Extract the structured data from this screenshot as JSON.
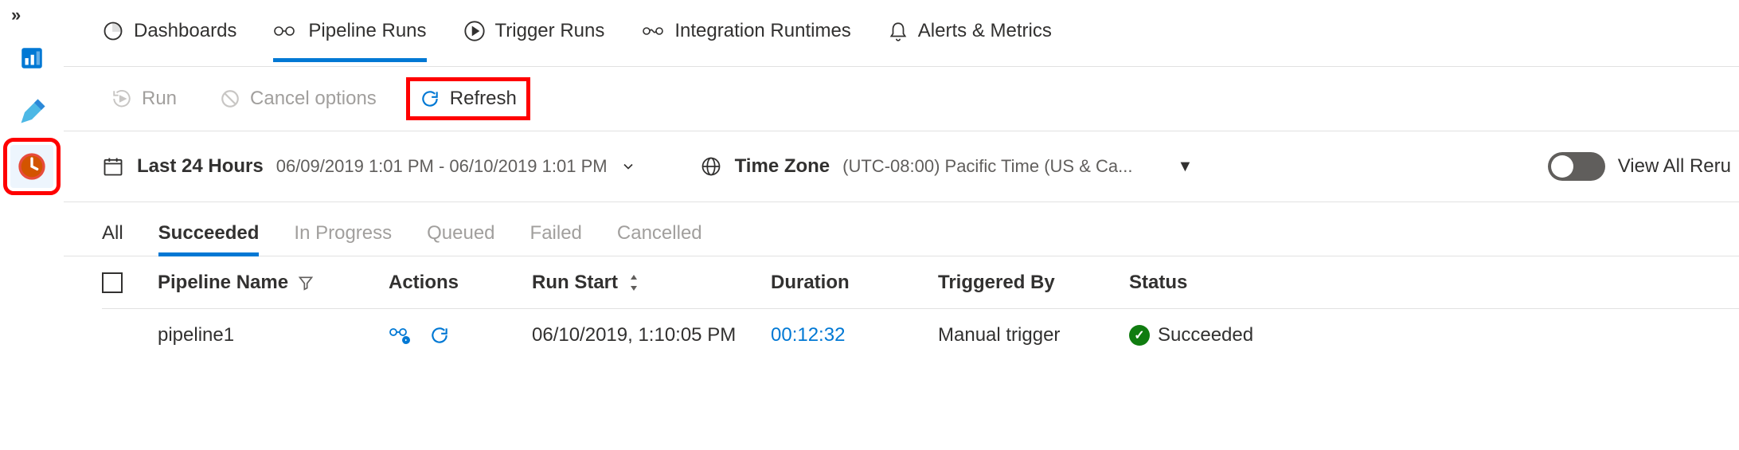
{
  "sidebar": {
    "expand_label": "»"
  },
  "tabs": {
    "dashboards": "Dashboards",
    "pipeline_runs": "Pipeline Runs",
    "trigger_runs": "Trigger Runs",
    "integration_runtimes": "Integration Runtimes",
    "alerts_metrics": "Alerts & Metrics"
  },
  "toolbar": {
    "run": "Run",
    "cancel_options": "Cancel options",
    "refresh": "Refresh"
  },
  "filters": {
    "time_range_label": "Last 24 Hours",
    "time_range_value": "06/09/2019 1:01 PM - 06/10/2019 1:01 PM",
    "time_zone_label": "Time Zone",
    "time_zone_value": "(UTC-08:00) Pacific Time (US & Ca...",
    "view_all": "View All Reru"
  },
  "status_tabs": {
    "all": "All",
    "succeeded": "Succeeded",
    "in_progress": "In Progress",
    "queued": "Queued",
    "failed": "Failed",
    "cancelled": "Cancelled"
  },
  "table": {
    "headers": {
      "pipeline_name": "Pipeline Name",
      "actions": "Actions",
      "run_start": "Run Start",
      "duration": "Duration",
      "triggered_by": "Triggered By",
      "status": "Status"
    },
    "rows": [
      {
        "pipeline_name": "pipeline1",
        "run_start": "06/10/2019, 1:10:05 PM",
        "duration": "00:12:32",
        "triggered_by": "Manual trigger",
        "status": "Succeeded"
      }
    ]
  }
}
